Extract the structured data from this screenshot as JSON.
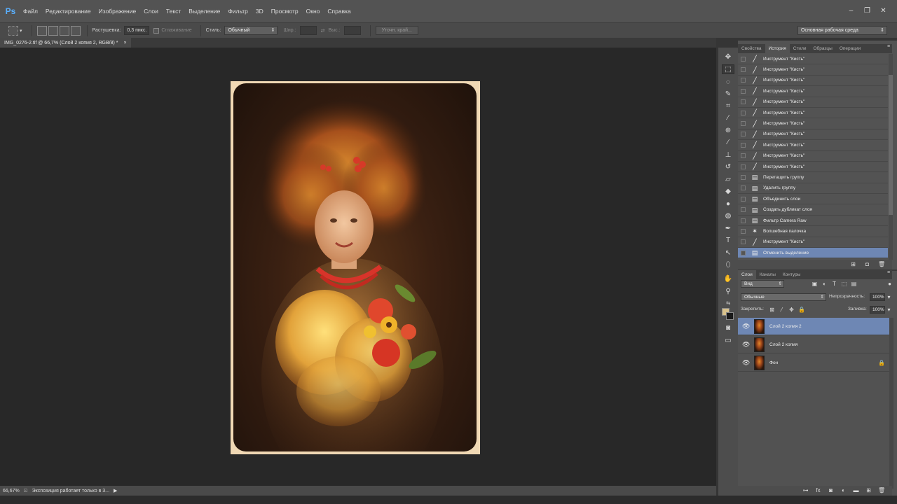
{
  "app": {
    "logo": "Ps"
  },
  "menu": [
    "Файл",
    "Редактирование",
    "Изображение",
    "Слои",
    "Текст",
    "Выделение",
    "Фильтр",
    "3D",
    "Просмотр",
    "Окно",
    "Справка"
  ],
  "options": {
    "feather_label": "Растушевка:",
    "feather_value": "0,3 пикс.",
    "antialias_label": "Сглаживание",
    "style_label": "Стиль:",
    "style_value": "Обычный",
    "width_label": "Шир.:",
    "height_label": "Выс.:",
    "refine_edge": "Уточн. край...",
    "workspace": "Основная рабочая среда"
  },
  "document": {
    "tab_title": "IMG_0276-2.tif @ 66,7% (Слой 2 копия 2, RGB/8) *",
    "close": "×"
  },
  "status": {
    "zoom": "66,67%",
    "message": "Экспозиция работает только в 3..."
  },
  "top_panel_tabs": [
    "Свойства",
    "История",
    "Стили",
    "Образцы",
    "Операции"
  ],
  "history": [
    {
      "icon": "brush-icon",
      "label": "Инструмент \"Кисть\""
    },
    {
      "icon": "brush-icon",
      "label": "Инструмент \"Кисть\""
    },
    {
      "icon": "brush-icon",
      "label": "Инструмент \"Кисть\""
    },
    {
      "icon": "brush-icon",
      "label": "Инструмент \"Кисть\""
    },
    {
      "icon": "brush-icon",
      "label": "Инструмент \"Кисть\""
    },
    {
      "icon": "brush-icon",
      "label": "Инструмент \"Кисть\""
    },
    {
      "icon": "brush-icon",
      "label": "Инструмент \"Кисть\""
    },
    {
      "icon": "brush-icon",
      "label": "Инструмент \"Кисть\""
    },
    {
      "icon": "brush-icon",
      "label": "Инструмент \"Кисть\""
    },
    {
      "icon": "brush-icon",
      "label": "Инструмент \"Кисть\""
    },
    {
      "icon": "brush-icon",
      "label": "Инструмент \"Кисть\""
    },
    {
      "icon": "document-icon",
      "label": "Перетащить группу"
    },
    {
      "icon": "document-icon",
      "label": "Удалить группу"
    },
    {
      "icon": "document-icon",
      "label": "Объединить слои"
    },
    {
      "icon": "document-icon",
      "label": "Создать дубликат слоя"
    },
    {
      "icon": "document-icon",
      "label": "Фильтр Camera Raw"
    },
    {
      "icon": "magic-wand-icon",
      "label": "Волшебная палочка"
    },
    {
      "icon": "brush-icon",
      "label": "Инструмент \"Кисть\""
    },
    {
      "icon": "document-icon",
      "label": "Отменить выделение"
    }
  ],
  "history_selected_index": 18,
  "layers_tabs": [
    "Слои",
    "Каналы",
    "Контуры"
  ],
  "layers_panel": {
    "filter_kind": "Вид",
    "blend_mode": "Обычные",
    "opacity_label": "Непрозрачность:",
    "opacity_value": "100%",
    "lock_label": "Закрепить:",
    "fill_label": "Заливка:",
    "fill_value": "100%"
  },
  "layers": [
    {
      "name": "Слой 2 копия 2",
      "selected": true,
      "locked": false
    },
    {
      "name": "Слой 2 копия",
      "selected": false,
      "locked": false
    },
    {
      "name": "Фон",
      "selected": false,
      "locked": true
    }
  ],
  "colors": {
    "selection": "#6e87b4",
    "panel": "#535353",
    "canvas_bg": "#282828"
  }
}
